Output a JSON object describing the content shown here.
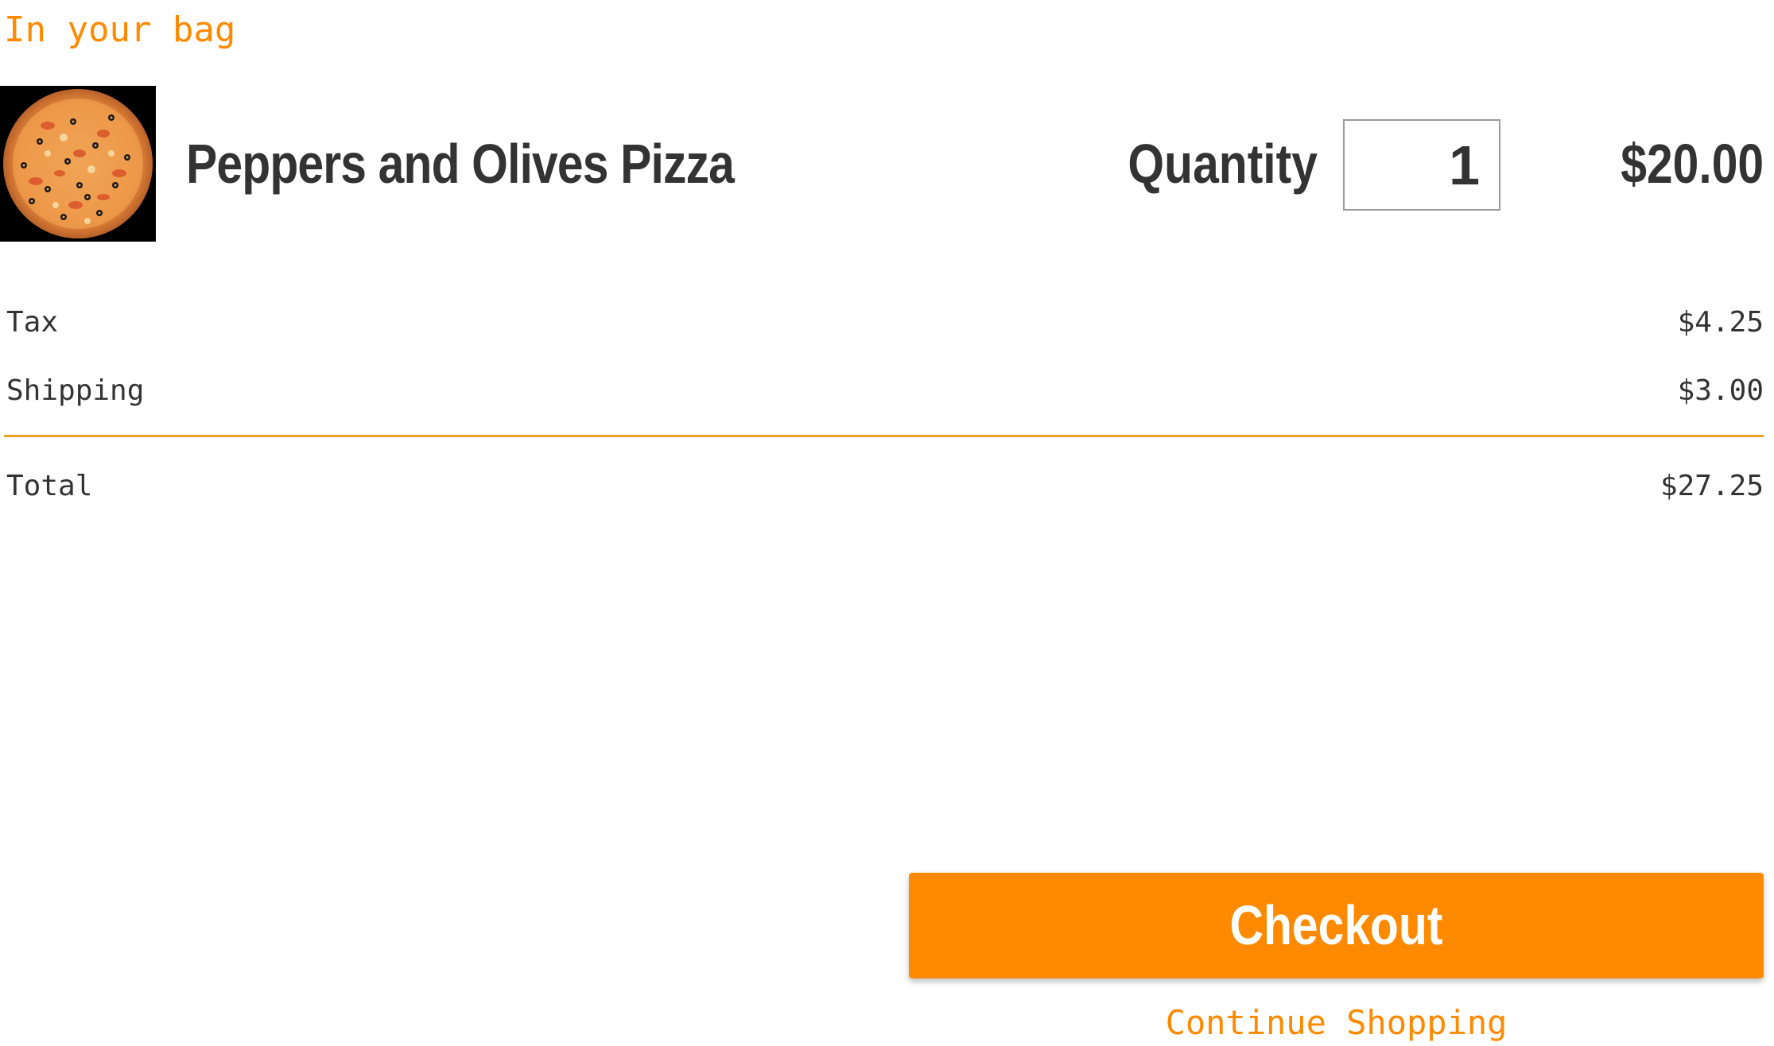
{
  "header": {
    "title": "In your bag"
  },
  "cart": {
    "items": [
      {
        "name": "Peppers and Olives Pizza",
        "image_icon": "pizza-image",
        "quantity_label": "Quantity",
        "quantity": "1",
        "price": "$20.00"
      }
    ]
  },
  "summary": {
    "tax_label": "Tax",
    "tax_value": "$4.25",
    "shipping_label": "Shipping",
    "shipping_value": "$3.00",
    "total_label": "Total",
    "total_value": "$27.25"
  },
  "actions": {
    "checkout_label": "Checkout",
    "continue_label": "Continue Shopping"
  },
  "colors": {
    "accent": "#ff8a00",
    "text": "#333333",
    "divider": "#f0a020"
  }
}
